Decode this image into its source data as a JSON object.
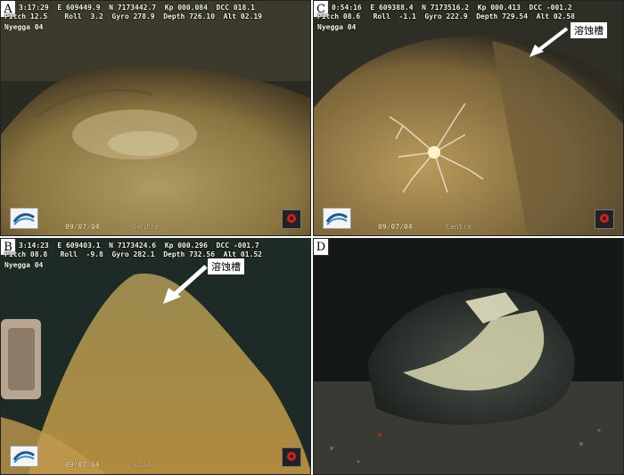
{
  "panels": {
    "A": {
      "label": "A",
      "hud_line1": "3:17:29  E 609449.9  N 7173442.7  Kp 000.084  DCC 018.1",
      "hud_line2": "Pitch 12.5    Roll  3.2  Gyro 278.9  Depth 726.10  Alt 02.19",
      "site": "Nyegga 04",
      "datestamp": "09/07/04",
      "camera": "Centre"
    },
    "B": {
      "label": "B",
      "hud_line1": "3:14:23  E 609403.1  N 7173424.6  Kp 000.296  DCC -001.7",
      "hud_line2": "Pitch 08.8   Roll  -9.8  Gyro 282.1  Depth 732.56  Alt 01.52",
      "site": "Nyegga 04",
      "datestamp": "09/07/04",
      "camera": "stbd",
      "callout": "溶蚀槽"
    },
    "C": {
      "label": "C",
      "hud_line1": "0:54:16  E 609388.4  N 7173516.2  Kp 000.413  DCC -001.2",
      "hud_line2": "Pitch 08.6   Roll  -1.1  Gyro 222.9  Depth 729.54  Alt 02.58",
      "site": "Nyegga 04",
      "datestamp": "09/07/04",
      "camera": "Centre",
      "callout": "溶蚀槽"
    },
    "D": {
      "label": "D"
    }
  },
  "colors": {
    "sediment": "#8a7440",
    "water": "#1d211f",
    "callout_bg": "#ffffff"
  }
}
